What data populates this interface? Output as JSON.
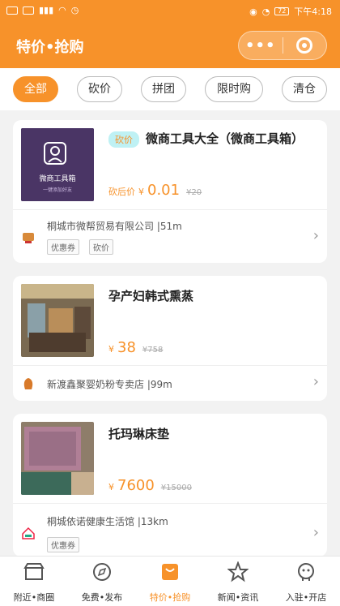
{
  "status_bar": {
    "time": "下午4:18",
    "battery": "72"
  },
  "header": {
    "title": "特价•抢购",
    "capsule_more": "•••"
  },
  "filters": [
    {
      "label": "全部"
    },
    {
      "label": "砍价"
    },
    {
      "label": "拼团"
    },
    {
      "label": "限时购"
    },
    {
      "label": "清仓"
    }
  ],
  "cards": [
    {
      "tag": "砍价",
      "title": "微商工具大全（微商工具箱）",
      "price_label": "砍后价",
      "currency": "¥",
      "price": "0.01",
      "orig_price": "¥20",
      "shop": "桐城市微帮贸易有限公司 |51m",
      "badges": [
        "优惠券",
        "砍价"
      ]
    },
    {
      "title": "孕产妇韩式熏蒸",
      "currency": "¥",
      "price": "38",
      "orig_price": "¥758",
      "shop": "新渡鑫聚婴奶粉专卖店 |99m"
    },
    {
      "title": "托玛琳床垫",
      "currency": "¥",
      "price": "7600",
      "orig_price": "¥15000",
      "shop": "桐城依诺健康生活馆 |13km",
      "badges": [
        "优惠券"
      ]
    }
  ],
  "thumb_1_text": {
    "line1": "微商工具箱",
    "line2": "一键添加好友"
  },
  "tabbar": [
    {
      "label": "附近•商圈",
      "icon": "store-icon"
    },
    {
      "label": "免费•发布",
      "icon": "compass-icon"
    },
    {
      "label": "特价•抢购",
      "icon": "bag-icon"
    },
    {
      "label": "新闻•资讯",
      "icon": "star-icon"
    },
    {
      "label": "入驻•开店",
      "icon": "robot-icon"
    }
  ],
  "colors": {
    "brand": "#f7922a",
    "tag_bg": "#bff1f4"
  }
}
